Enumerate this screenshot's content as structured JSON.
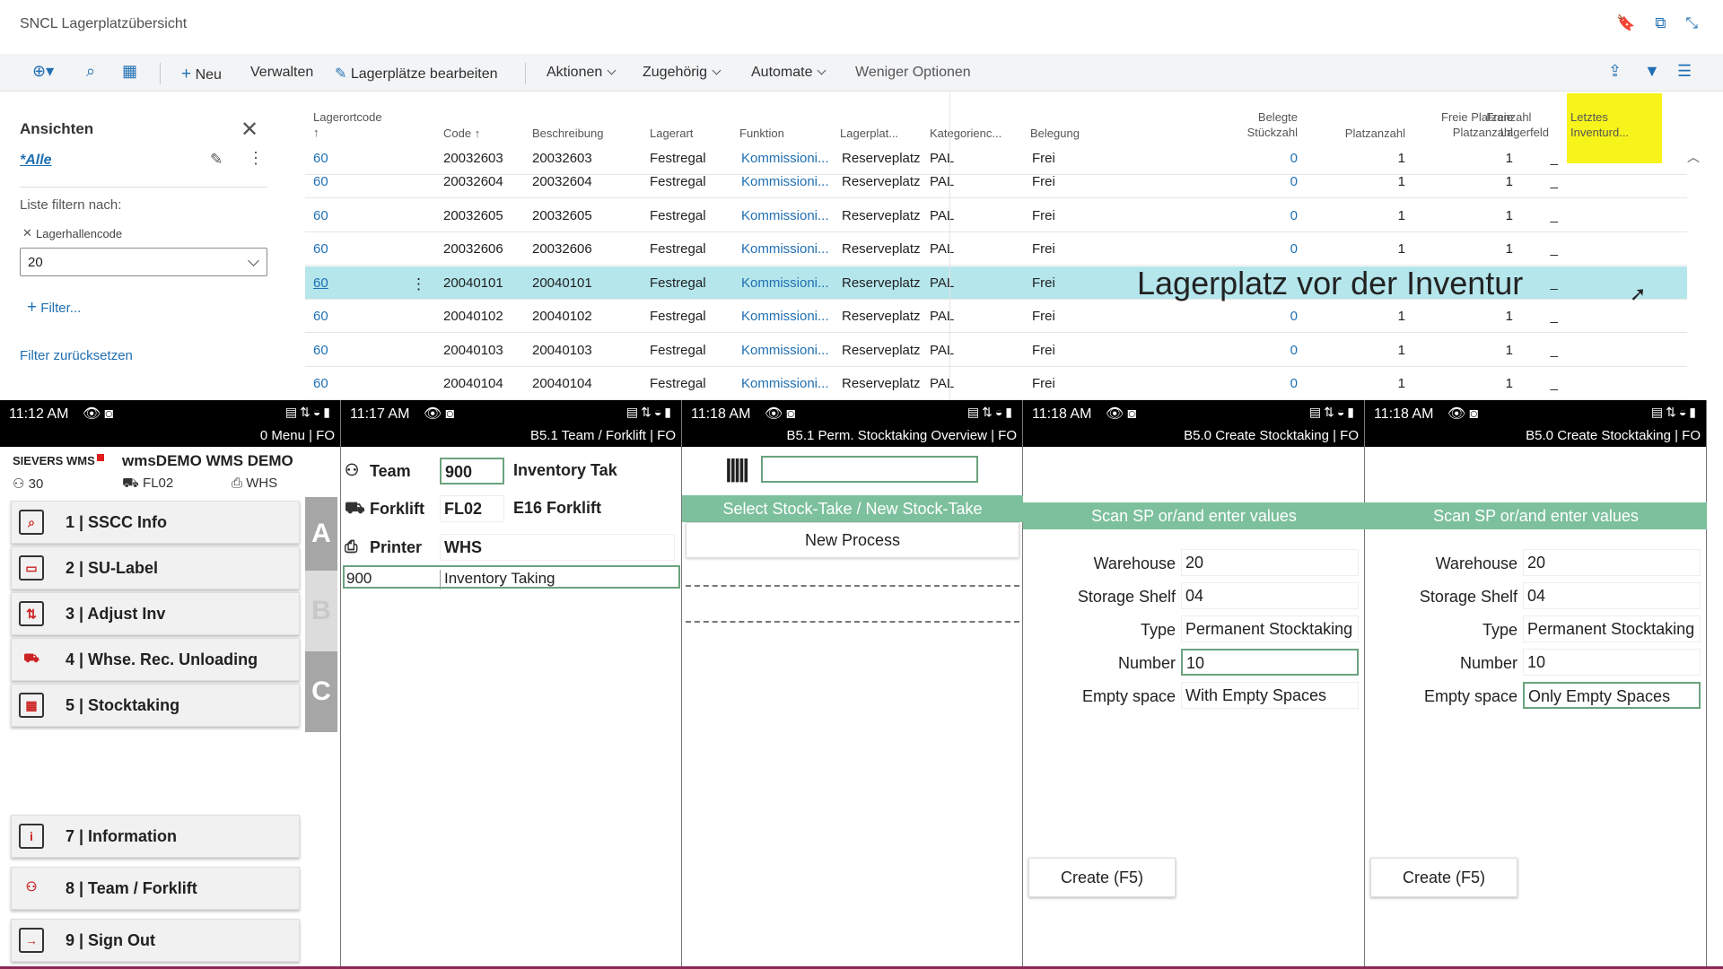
{
  "window": {
    "title": "SNCL Lagerplatzübersicht"
  },
  "toolbar": {
    "new": "Neu",
    "manage": "Verwalten",
    "edit_bins": "Lagerplätze bearbeiten",
    "actions": "Aktionen",
    "related": "Zugehörig",
    "automate": "Automate",
    "fewer": "Weniger Optionen"
  },
  "views": {
    "title": "Ansichten",
    "all": "*Alle",
    "filter_by": "Liste filtern nach:",
    "filter_field": "Lagerhallencode",
    "filter_value": "20",
    "add_filter": "Filter...",
    "reset": "Filter zurücksetzen"
  },
  "grid": {
    "headers": {
      "loc1": "Lagerortcode",
      "loc2": "↑",
      "code": "Code ↑",
      "desc": "Beschreibung",
      "type": "Lagerart",
      "func": "Funktion",
      "bintype": "Lagerplat...",
      "cat": "Kategorienc...",
      "occ": "Belegung",
      "qty1": "Belegte",
      "qty2": "Stückzahl",
      "count": "Platzanzahl",
      "free1": "Freie",
      "free2": "Platzanzahl",
      "freef1": "Freie Platzanzahl",
      "freef2": "Lagerfeld",
      "last1": "Letztes",
      "last2": "Inventurd..."
    },
    "rows": [
      {
        "loc": "60",
        "code": "20032603",
        "desc": "20032603",
        "type": "Festregal",
        "func": "Kommissioni...",
        "bintype": "Reserveplatz",
        "cat": "PAL",
        "occ": "Frei",
        "qty": "0",
        "count": "1",
        "free": "1",
        "freef": "_"
      },
      {
        "loc": "60",
        "code": "20032604",
        "desc": "20032604",
        "type": "Festregal",
        "func": "Kommissioni...",
        "bintype": "Reserveplatz",
        "cat": "PAL",
        "occ": "Frei",
        "qty": "0",
        "count": "1",
        "free": "1",
        "freef": "_"
      },
      {
        "loc": "60",
        "code": "20032605",
        "desc": "20032605",
        "type": "Festregal",
        "func": "Kommissioni...",
        "bintype": "Reserveplatz",
        "cat": "PAL",
        "occ": "Frei",
        "qty": "0",
        "count": "1",
        "free": "1",
        "freef": "_"
      },
      {
        "loc": "60",
        "code": "20032606",
        "desc": "20032606",
        "type": "Festregal",
        "func": "Kommissioni...",
        "bintype": "Reserveplatz",
        "cat": "PAL",
        "occ": "Frei",
        "qty": "0",
        "count": "1",
        "free": "1",
        "freef": "_"
      },
      {
        "loc": "60",
        "code": "20040101",
        "desc": "20040101",
        "type": "Festregal",
        "func": "Kommissioni...",
        "bintype": "Reserveplatz",
        "cat": "PAL",
        "occ": "Frei",
        "qty": "",
        "count": "",
        "free": "",
        "freef": "_"
      },
      {
        "loc": "60",
        "code": "20040102",
        "desc": "20040102",
        "type": "Festregal",
        "func": "Kommissioni...",
        "bintype": "Reserveplatz",
        "cat": "PAL",
        "occ": "Frei",
        "qty": "0",
        "count": "1",
        "free": "1",
        "freef": "_"
      },
      {
        "loc": "60",
        "code": "20040103",
        "desc": "20040103",
        "type": "Festregal",
        "func": "Kommissioni...",
        "bintype": "Reserveplatz",
        "cat": "PAL",
        "occ": "Frei",
        "qty": "0",
        "count": "1",
        "free": "1",
        "freef": "_"
      },
      {
        "loc": "60",
        "code": "20040104",
        "desc": "20040104",
        "type": "Festregal",
        "func": "Kommissioni...",
        "bintype": "Reserveplatz",
        "cat": "PAL",
        "occ": "Frei",
        "qty": "0",
        "count": "1",
        "free": "1",
        "freef": "_"
      }
    ],
    "overlay": "Lagerplatz vor der Inventur"
  },
  "phone1": {
    "time": "11:12 AM",
    "subtitle": "0 Menu | FO",
    "logo": "SIEVERS WMS",
    "name": "wmsDEMO WMS DEMO",
    "team": "30",
    "forklift": "FL02",
    "printer": "WHS",
    "items": [
      "1 | SSCC Info",
      "2 | SU-Label",
      "3 | Adjust Inv",
      "4 | Whse. Rec. Unloading",
      "5 | Stocktaking"
    ],
    "bottom_items": [
      "7 | Information",
      "8 | Team / Forklift",
      "9 | Sign Out"
    ],
    "tabs": [
      "A",
      "B",
      "C"
    ]
  },
  "phone2": {
    "time": "11:17 AM",
    "subtitle": "B5.1 Team / Forklift | FO",
    "team_label": "Team",
    "team_value": "900",
    "team_desc": "Inventory Tak",
    "forklift_label": "Forklift",
    "forklift_value": "FL02",
    "forklift_desc": "E16 Forklift",
    "printer_label": "Printer",
    "printer_value": "WHS",
    "list_code": "900",
    "list_desc": "Inventory Taking"
  },
  "phone3": {
    "time": "11:18 AM",
    "subtitle": "B5.1 Perm. Stocktaking Overview | FO",
    "header": "Select Stock-Take / New Stock-Take",
    "new_process": "New Process"
  },
  "phone4": {
    "time": "11:18 AM",
    "subtitle": "B5.0 Create Stocktaking | FO",
    "header": "Scan SP or/and enter values",
    "labels": {
      "warehouse": "Warehouse",
      "shelf": "Storage Shelf",
      "type": "Type",
      "number": "Number",
      "empty": "Empty space"
    },
    "values": {
      "warehouse": "20",
      "shelf": "04",
      "type": "Permanent Stocktaking",
      "number": "10",
      "empty": "With Empty Spaces"
    },
    "create": "Create (F5)"
  },
  "phone5": {
    "time": "11:18 AM",
    "subtitle": "B5.0 Create Stocktaking | FO",
    "header": "Scan SP or/and enter values",
    "labels": {
      "warehouse": "Warehouse",
      "shelf": "Storage Shelf",
      "type": "Type",
      "number": "Number",
      "empty": "Empty space"
    },
    "values": {
      "warehouse": "20",
      "shelf": "04",
      "type": "Permanent Stocktaking",
      "number": "10",
      "empty": "Only Empty Spaces"
    },
    "create": "Create (F5)"
  },
  "colors": {
    "accent": "#1f6fb2",
    "selected_row": "#b4e6ec",
    "highlight": "#f7f41b",
    "green": "#7dc09d"
  }
}
